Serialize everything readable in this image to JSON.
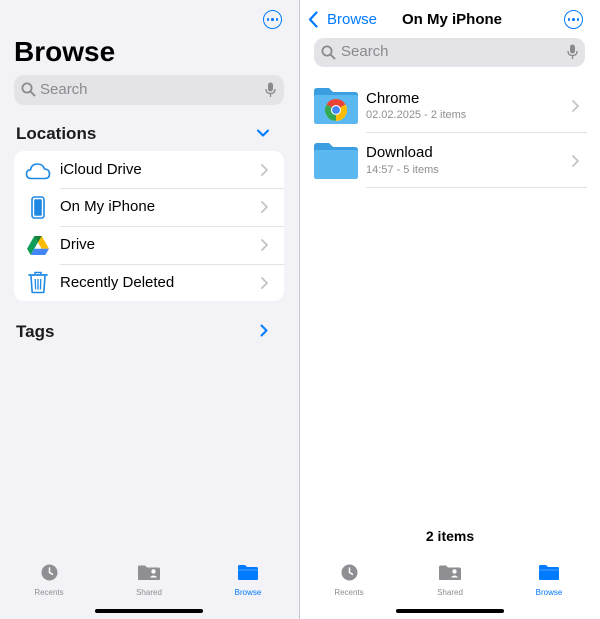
{
  "left": {
    "title": "Browse",
    "search_placeholder": "Search",
    "locations": {
      "heading": "Locations",
      "items": [
        {
          "label": "iCloud Drive"
        },
        {
          "label": "On My iPhone"
        },
        {
          "label": "Drive"
        },
        {
          "label": "Recently Deleted"
        }
      ]
    },
    "tags": {
      "heading": "Tags"
    }
  },
  "right": {
    "back_label": "Browse",
    "title": "On My iPhone",
    "search_placeholder": "Search",
    "files": [
      {
        "name": "Chrome",
        "meta": "02.02.2025 - 2 items"
      },
      {
        "name": "Download",
        "meta": "14:57 - 5 items"
      }
    ],
    "footer_count": "2 items"
  },
  "tabs": [
    {
      "label": "Recents",
      "icon": "clock-icon"
    },
    {
      "label": "Shared",
      "icon": "shared-folder-icon"
    },
    {
      "label": "Browse",
      "icon": "folder-icon",
      "active": true
    }
  ],
  "colors": {
    "accent": "#007aff",
    "folder": "#4aaee8",
    "background": "#f2f2f7"
  }
}
